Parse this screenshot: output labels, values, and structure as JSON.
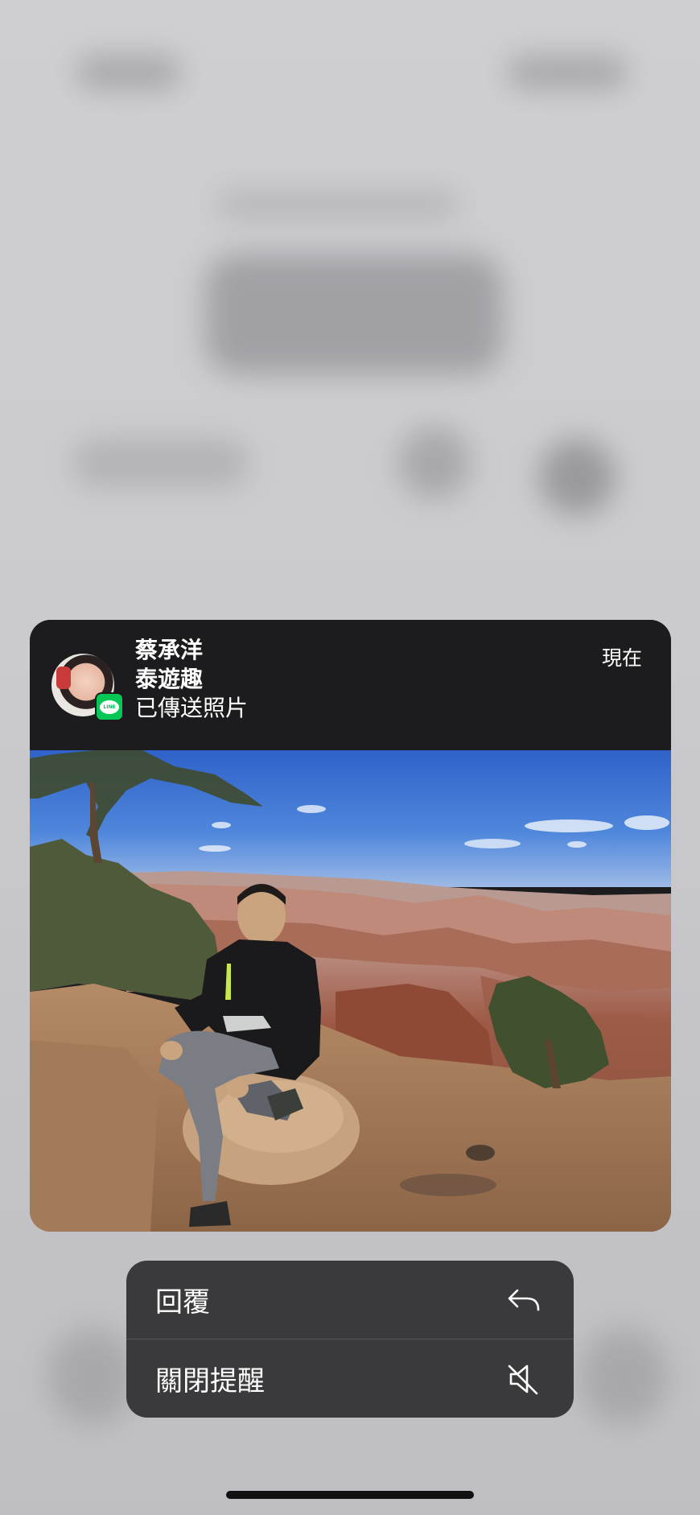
{
  "notification": {
    "sender": "蔡承洋",
    "group": "泰遊趣",
    "message": "已傳送照片",
    "time": "現在",
    "app_badge": "LINE"
  },
  "actions": {
    "reply_label": "回覆",
    "mute_label": "關閉提醒"
  },
  "icons": {
    "reply": "reply-arrow-icon",
    "mute": "speaker-muted-icon",
    "app": "line-app-icon"
  },
  "colors": {
    "card": "#1c1c1e",
    "menu": "#3a3a3c",
    "line_green": "#06c755"
  }
}
